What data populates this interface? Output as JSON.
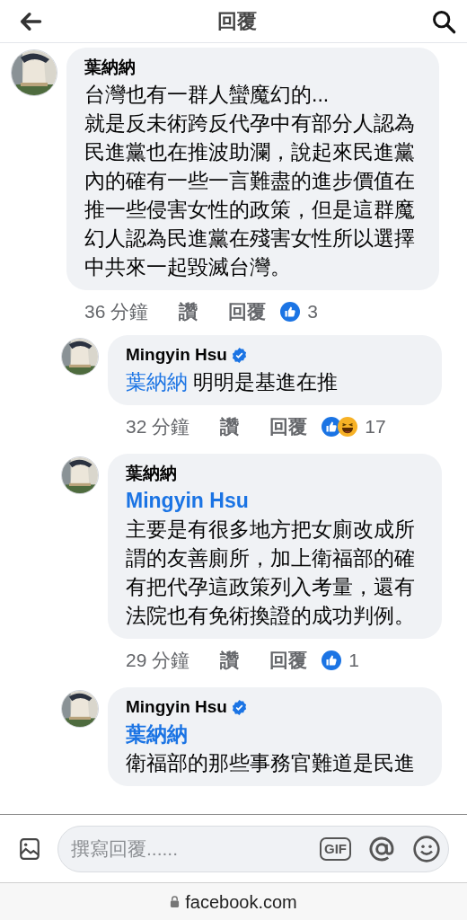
{
  "header": {
    "title": "回覆"
  },
  "comment": {
    "author": "葉納納",
    "verified": false,
    "text": "台灣也有一群人蠻魔幻的...\n就是反未術跨反代孕中有部分人認為民進黨也在推波助瀾，說起來民進黨內的確有一些一言難盡的進步價值在推一些侵害女性的政策，但是這群魔幻人認為民進黨在殘害女性所以選擇中共來一起毀滅台灣。",
    "time": "36 分鐘",
    "like": "讚",
    "reply": "回覆",
    "reactions": [
      {
        "kind": "like"
      }
    ],
    "count": "3",
    "children": [
      {
        "author": "Mingyin Hsu",
        "verified": true,
        "mention": "葉納納",
        "mention_inline": true,
        "text": "明明是基進在推",
        "time": "32 分鐘",
        "like": "讚",
        "reply": "回覆",
        "reactions": [
          {
            "kind": "like"
          },
          {
            "kind": "haha"
          }
        ],
        "count": "17"
      },
      {
        "author": "葉納納",
        "verified": false,
        "mention": "Mingyin Hsu",
        "mention_inline": false,
        "text": "主要是有很多地方把女廁改成所謂的友善廁所，加上衛福部的確有把代孕這政策列入考量，還有法院也有免術換證的成功判例。",
        "time": "29 分鐘",
        "like": "讚",
        "reply": "回覆",
        "reactions": [
          {
            "kind": "like"
          }
        ],
        "count": "1"
      },
      {
        "author": "Mingyin Hsu",
        "verified": true,
        "mention": "葉納納",
        "mention_inline": false,
        "text": "衛福部的那些事務官難道是民進"
      }
    ]
  },
  "composer": {
    "placeholder": "撰寫回覆......",
    "gif": "GIF"
  },
  "address_bar": {
    "url": "facebook.com"
  }
}
